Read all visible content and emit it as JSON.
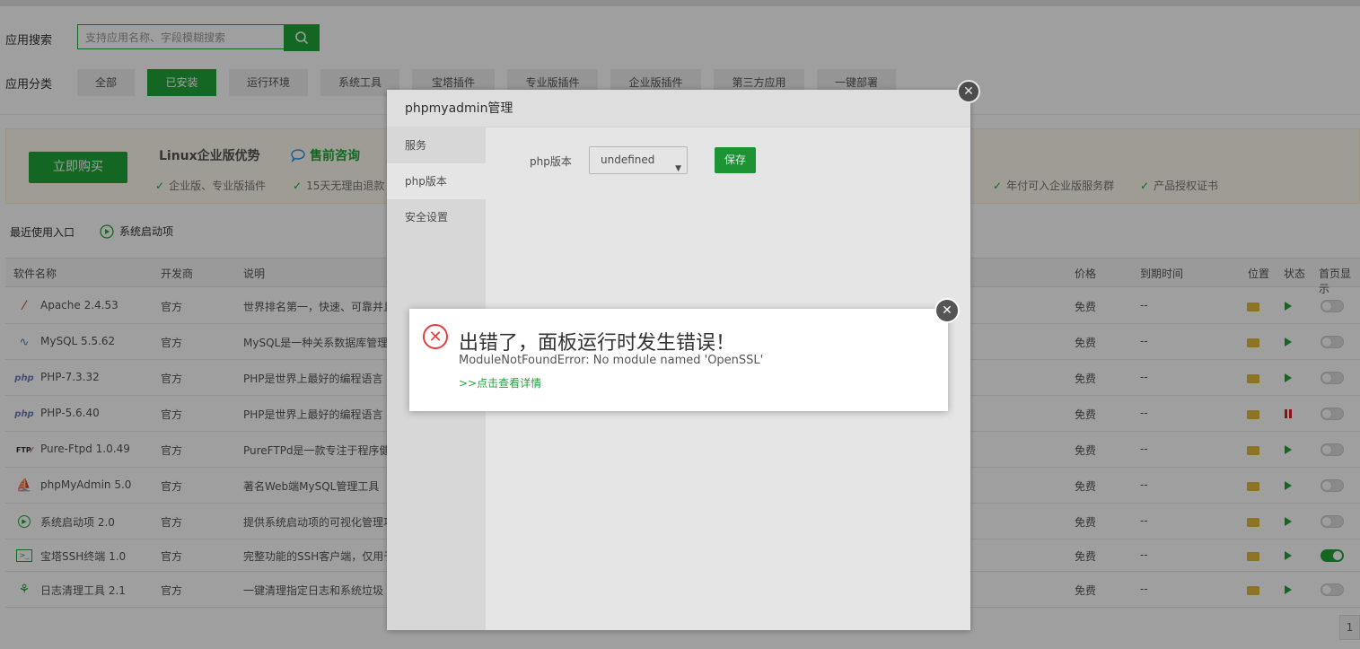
{
  "search": {
    "label": "应用搜索",
    "placeholder": "支持应用名称、字段模糊搜索"
  },
  "categories": {
    "label": "应用分类",
    "items": [
      "全部",
      "已安装",
      "运行环境",
      "系统工具",
      "宝塔插件",
      "专业版插件",
      "企业版插件",
      "第三方应用",
      "一键部署"
    ],
    "active": "已安装"
  },
  "promo": {
    "buy": "立即购买",
    "title": "Linux企业版优势",
    "consult": "售前咨询",
    "features": [
      "企业版、专业版插件",
      "15天无理由退款",
      "年付可入企业版服务群",
      "产品授权证书"
    ]
  },
  "links": {
    "recent": "最近使用入口",
    "startup": "系统启动项"
  },
  "table": {
    "headers": [
      "软件名称",
      "开发商",
      "说明",
      "价格",
      "到期时间",
      "位置",
      "状态",
      "首页显示"
    ],
    "rows": [
      {
        "icon": "apache-icon",
        "name": "Apache 2.4.53",
        "dev": "官方",
        "desc": "世界排名第一，快速、可靠并且",
        "price": "免费",
        "expire": "--",
        "status": "running",
        "home": false
      },
      {
        "icon": "mysql-icon",
        "name": "MySQL 5.5.62",
        "dev": "官方",
        "desc": "MySQL是一种关系数据库管理",
        "price": "免费",
        "expire": "--",
        "status": "running",
        "home": false
      },
      {
        "icon": "php-icon",
        "name": "PHP-7.3.32",
        "dev": "官方",
        "desc": "PHP是世界上最好的编程语言",
        "price": "免费",
        "expire": "--",
        "status": "running",
        "home": false
      },
      {
        "icon": "php-icon",
        "name": "PHP-5.6.40",
        "dev": "官方",
        "desc": "PHP是世界上最好的编程语言",
        "price": "免费",
        "expire": "--",
        "status": "stopped",
        "home": false
      },
      {
        "icon": "ftp-icon",
        "name": "Pure-Ftpd 1.0.49",
        "dev": "官方",
        "desc": "PureFTPd是一款专注于程序健",
        "price": "免费",
        "expire": "--",
        "status": "running",
        "home": false
      },
      {
        "icon": "phpmyadmin-icon",
        "name": "phpMyAdmin 5.0",
        "dev": "官方",
        "desc": "著名Web端MySQL管理工具",
        "price": "免费",
        "expire": "--",
        "status": "running",
        "home": false
      },
      {
        "icon": "startup-icon",
        "name": "系统启动项 2.0",
        "dev": "官方",
        "desc": "提供系统启动项的可视化管理功",
        "price": "免费",
        "expire": "--",
        "status": "running",
        "home": false
      },
      {
        "icon": "terminal-icon",
        "name": "宝塔SSH终端 1.0",
        "dev": "官方",
        "desc": "完整功能的SSH客户端，仅用于",
        "price": "免费",
        "expire": "--",
        "status": "running",
        "home": true
      },
      {
        "icon": "broom-icon",
        "name": "日志清理工具 2.1",
        "dev": "官方",
        "desc": "一键清理指定日志和系统垃圾",
        "price": "免费",
        "expire": "--",
        "status": "running",
        "home": false
      }
    ]
  },
  "pager": {
    "page": "1"
  },
  "modal": {
    "title": "phpmyadmin管理",
    "tabs": [
      "服务",
      "php版本",
      "安全设置"
    ],
    "active_tab": "php版本",
    "php_label": "php版本",
    "php_value": "undefined",
    "save": "保存"
  },
  "error": {
    "title": "出错了，面板运行时发生错误！",
    "message": "ModuleNotFoundError: No module named 'OpenSSL'",
    "link": ">>点击查看详情"
  },
  "colors": {
    "accent": "#20a53a",
    "error": "#e24040",
    "folder": "#e6b83c",
    "stop": "#e02020"
  }
}
